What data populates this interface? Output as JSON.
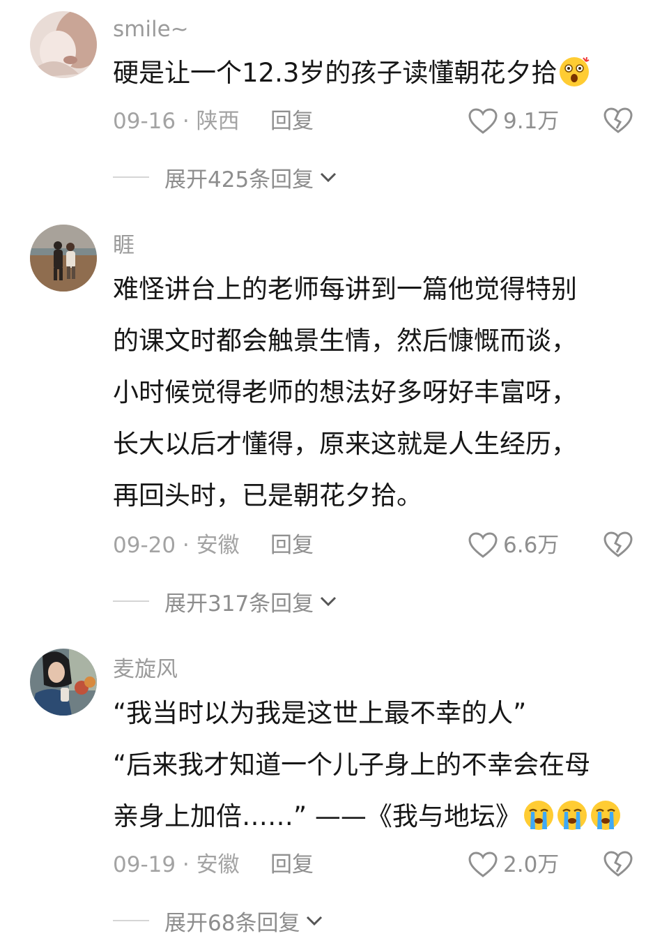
{
  "comments": [
    {
      "username": "smile~",
      "lines": [
        "硬是让一个12.3岁的孩子读懂朝花夕拾"
      ],
      "emoji": "shocked-face-icon",
      "date_location": "09-16 · 陕西",
      "reply_label": "回复",
      "likes": "9.1万",
      "expand_label": "展开425条回复"
    },
    {
      "username": "睚",
      "lines": [
        "难怪讲台上的老师每讲到一篇他觉得特别",
        "的课文时都会触景生情，然后慷慨而谈，",
        "小时候觉得老师的想法好多呀好丰富呀，",
        "长大以后才懂得，原来这就是人生经历，",
        "再回头时，已是朝花夕拾。"
      ],
      "date_location": "09-20 · 安徽",
      "reply_label": "回复",
      "likes": "6.6万",
      "expand_label": "展开317条回复"
    },
    {
      "username": "麦旋风",
      "lines": [
        "“我当时以为我是这世上最不幸的人”",
        "“后来我才知道一个儿子身上的不幸会在母",
        "亲身上加倍……” ——《我与地坛》"
      ],
      "emoji": "loudly-crying-face-icon",
      "date_location": "09-19 · 安徽",
      "reply_label": "回复",
      "likes": "2.0万",
      "expand_label": "展开68条回复"
    }
  ],
  "colors": {
    "text": "#161616",
    "muted": "#9b9b9b",
    "background": "#ffffff"
  }
}
